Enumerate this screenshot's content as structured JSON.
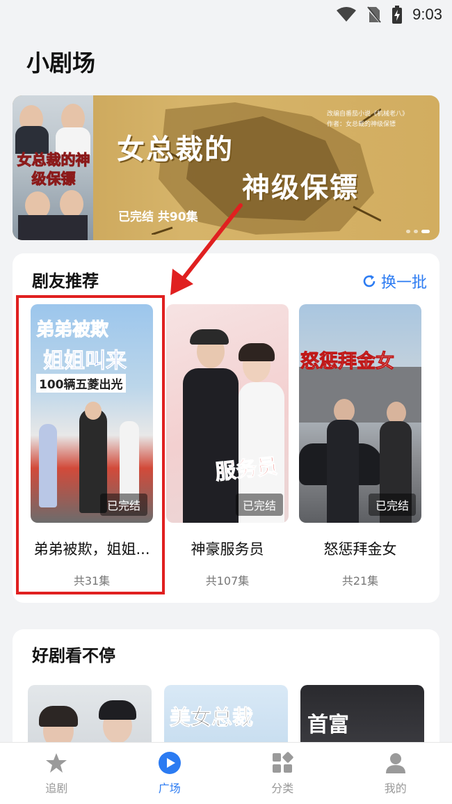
{
  "status_bar": {
    "time": "9:03"
  },
  "page_title": "小剧场",
  "banner": {
    "poster_title": "女总裁的神级保镖",
    "title_line1": "女总裁的",
    "title_line2": "神级保镖",
    "credit_line1": "改编自番茄小说《机械老八》",
    "credit_line2": "作者：女总裁的神级保镖",
    "status": "已完结 共90集",
    "active_dot": 2
  },
  "recommend": {
    "title": "剧友推荐",
    "refresh_label": "换一批",
    "dramas": [
      {
        "name": "弟弟被欺，姐姐叫来100辆五菱出光",
        "display_name": "弟弟被欺，姐姐...",
        "episodes": "共31集",
        "badge": "已完结",
        "cover_text": [
          "弟弟被欺",
          "姐姐叫来",
          "100辆五菱出光"
        ]
      },
      {
        "name": "神豪服务员",
        "display_name": "神豪服务员",
        "episodes": "共107集",
        "badge": "已完结",
        "cover_text": [
          "服务员"
        ]
      },
      {
        "name": "怒惩拜金女",
        "display_name": "怒惩拜金女",
        "episodes": "共21集",
        "badge": "已完结",
        "cover_text": [
          "怒惩拜金女"
        ]
      }
    ]
  },
  "binge": {
    "title": "好剧看不停",
    "thumb_texts": [
      "",
      "美女总裁",
      "首富"
    ]
  },
  "nav": {
    "items": [
      {
        "label": "追剧",
        "icon": "star-icon"
      },
      {
        "label": "广场",
        "icon": "play-icon"
      },
      {
        "label": "分类",
        "icon": "category-icon"
      },
      {
        "label": "我的",
        "icon": "profile-icon"
      }
    ],
    "active_index": 1
  },
  "colors": {
    "accent": "#2b7bf2",
    "annotation": "#e02020"
  }
}
